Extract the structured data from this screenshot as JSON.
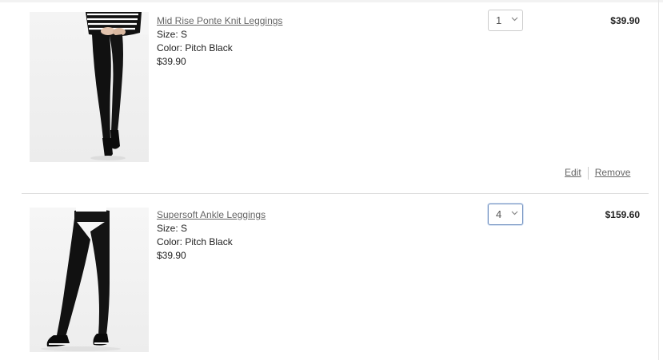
{
  "cart": {
    "items": [
      {
        "name": "Mid Rise Ponte Knit Leggings",
        "size": "Size: S",
        "color": "Color: Pitch Black",
        "price": "$39.90",
        "quantity": "1",
        "total": "$39.90",
        "image": "leggings-product-image-cropped",
        "actions": {
          "edit": "Edit",
          "remove": "Remove"
        }
      },
      {
        "name": "Supersoft Ankle Leggings",
        "size": "Size: S",
        "color": "Color: Pitch Black",
        "price": "$39.90",
        "quantity": "4",
        "total": "$159.60",
        "image": "leggings-product-image-full"
      }
    ]
  },
  "colors": {
    "link": "#666666",
    "focus_border": "#6f8fbf",
    "divider": "#dcdcdc"
  },
  "icons": {
    "quantity_dropdown": "chevron-down-icon"
  }
}
